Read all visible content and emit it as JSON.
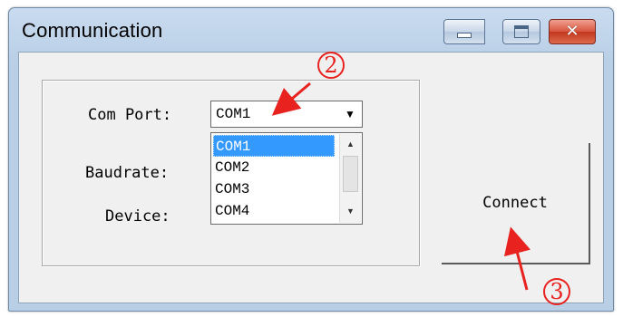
{
  "window": {
    "title": "Communication",
    "buttons": {
      "minimize": "minimize-icon",
      "maximize": "maximize-icon",
      "close": "close-icon"
    }
  },
  "form": {
    "com_port_label": "Com Port:",
    "baudrate_label": "Baudrate:",
    "device_label": "Device:",
    "com_port_value": "COM1",
    "dropdown_options": [
      "COM1",
      "COM2",
      "COM3",
      "COM4"
    ],
    "selected_option": "COM1"
  },
  "connect_button": {
    "label": "Connect"
  },
  "annotations": {
    "step_2": "2",
    "step_3": "3"
  },
  "colors": {
    "annotation": "#e8231f",
    "selection": "#3399ff",
    "title_bar": "#c9dbef"
  }
}
